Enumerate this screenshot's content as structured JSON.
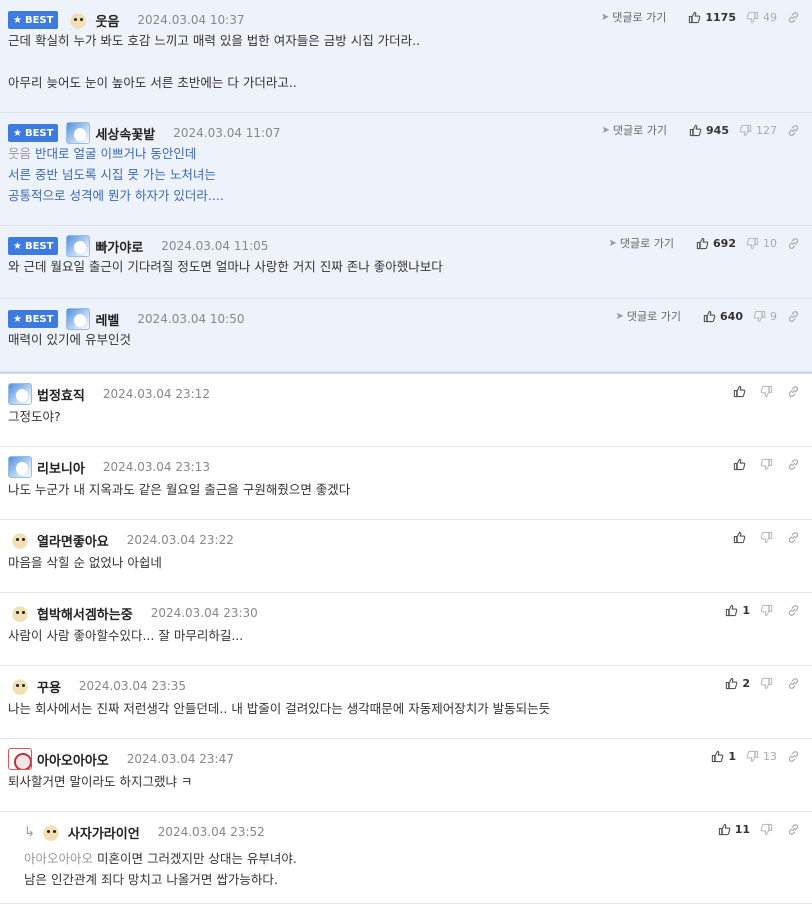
{
  "ui": {
    "reply_label": "댓글로 가기",
    "best_label": "BEST"
  },
  "best": [
    {
      "name": "웃음",
      "time": "2024.03.04 10:37",
      "up": "1175",
      "down": "49",
      "avatar": "dog",
      "lines": [
        "근데 확실히 누가 봐도 호감 느끼고 매력 있을 법한 여자들은 금방 시집 가더라..",
        "",
        "아무리 늦어도 눈이 높아도 서른 초반에는 다 가더라고.."
      ]
    },
    {
      "name": "세상속꽃밭",
      "time": "2024.03.04 11:07",
      "up": "945",
      "down": "127",
      "avatar": "blue",
      "mention": "웃음",
      "lines": [
        "반대로 얼굴 이쁘거나 동안인데",
        "서른 중반 넘도록 시집 못 가는 노처녀는",
        "공통적으로 성격에 뭔가 하자가 있더라...."
      ]
    },
    {
      "name": "빠가야로",
      "time": "2024.03.04 11:05",
      "up": "692",
      "down": "10",
      "avatar": "blue",
      "lines": [
        "와 근데 월요일 출근이 기다려질 정도면 얼마나 사랑한 거지 진짜 존나 좋아했나보다"
      ]
    },
    {
      "name": "레벨",
      "time": "2024.03.04 10:50",
      "up": "640",
      "down": "9",
      "avatar": "blue",
      "lines": [
        "매력이 있기에 유부인것"
      ]
    }
  ],
  "comments": [
    {
      "name": "법정효직",
      "time": "2024.03.04 23:12",
      "up": "",
      "down": "",
      "avatar": "blue",
      "lines": [
        "그정도야?"
      ]
    },
    {
      "name": "리보니아",
      "time": "2024.03.04 23:13",
      "up": "",
      "down": "",
      "avatar": "blue",
      "lines": [
        "나도 누군가 내 지옥과도 같은 월요일 출근을 구원해줬으면 좋겠다"
      ]
    },
    {
      "name": "열라면좋아요",
      "time": "2024.03.04 23:22",
      "up": "",
      "down": "",
      "avatar": "dog",
      "lines": [
        "마음을 삭힐 순 없었나 아쉽네"
      ]
    },
    {
      "name": "협박해서겜하는중",
      "time": "2024.03.04 23:30",
      "up": "1",
      "down": "",
      "avatar": "dog",
      "lines": [
        "사람이 사람 좋아할수있다... 잘 마무리하길..."
      ]
    },
    {
      "name": "꾸용",
      "time": "2024.03.04 23:35",
      "up": "2",
      "down": "",
      "avatar": "dog",
      "lines": [
        "나는 회사에서는 진짜 저런생각 안들던데.. 내 밥줄이 걸려있다는 생각때문에 자동제어장치가 발동되는듯"
      ]
    },
    {
      "name": "아아오아아오",
      "time": "2024.03.04 23:47",
      "up": "1",
      "down": "13",
      "avatar": "red",
      "lines": [
        "퇴사할거면 말이라도 하지그랬냐 ㅋ"
      ]
    }
  ],
  "reply": {
    "name": "사자가라이언",
    "time": "2024.03.04 23:52",
    "up": "11",
    "down": "",
    "avatar": "dog",
    "mention": "아아오아아오",
    "lines": [
      "미혼이면 그러겠지만 상대는 유부녀야.",
      "남은 인간관계 죄다 망치고 나올거면 쌉가능하다."
    ]
  }
}
